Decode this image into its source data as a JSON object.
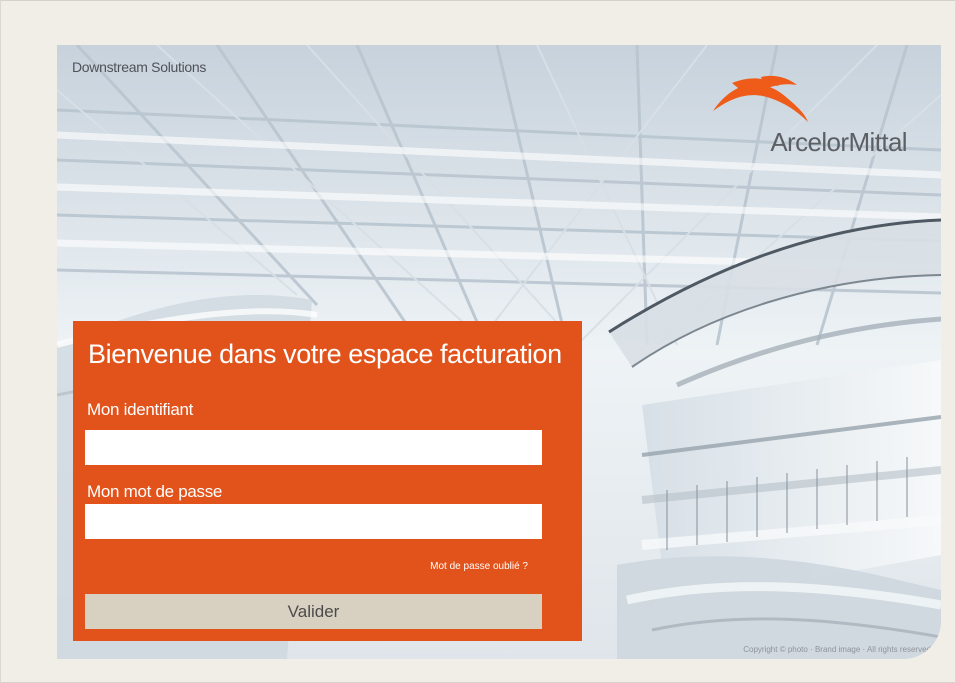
{
  "hero": {
    "caption": "Downstream Solutions",
    "photo_credit": "Copyright © photo · Brand image · All rights reserved"
  },
  "brand": {
    "name": "ArcelorMittal",
    "accent_color": "#e2531b",
    "button_color": "#d8d1c1"
  },
  "login": {
    "title": "Bienvenue dans votre espace facturation",
    "username_label": "Mon identifiant",
    "username_value": "",
    "password_label": "Mon mot de passe",
    "password_value": "",
    "forgot_password": "Mot de passe oublié ?",
    "submit_label": "Valider"
  }
}
